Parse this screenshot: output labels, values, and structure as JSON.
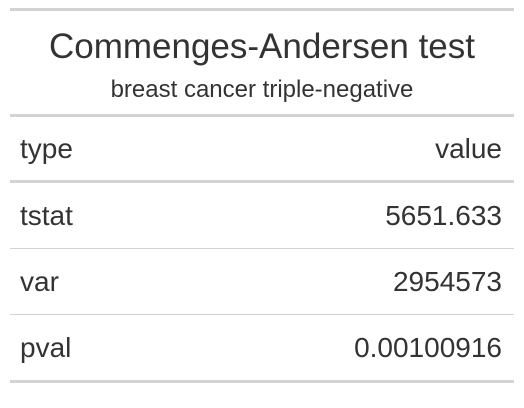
{
  "heading": {
    "title": "Commenges-Andersen test",
    "subtitle": "breast cancer triple-negative"
  },
  "columns": {
    "type": "type",
    "value": "value"
  },
  "rows": [
    {
      "type": "tstat",
      "value": "5651.633"
    },
    {
      "type": "var",
      "value": "2954573"
    },
    {
      "type": "pval",
      "value": "0.00100916"
    }
  ]
}
